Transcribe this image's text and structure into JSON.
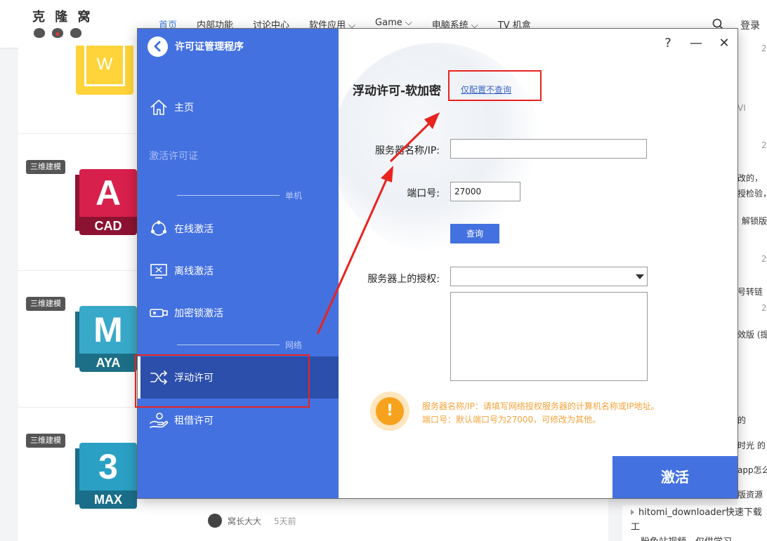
{
  "site": {
    "logo_text": "克 隆 窝",
    "nav": [
      "首页",
      "内部功能",
      "讨论中心",
      "软件应用 ⌵",
      "Game ⌵",
      "电脑系统 ⌵",
      "TV 机盒"
    ],
    "login": "登录",
    "tags": [
      "三维建模",
      "三维建模",
      "三维建模"
    ],
    "tiles": [
      {
        "letter": "A",
        "label": "CAD",
        "color": "#d8204c",
        "dark": "#8c1232"
      },
      {
        "letter": "M",
        "label": "AYA",
        "color": "#39a9c9",
        "dark": "#1c6f87"
      },
      {
        "letter": "3",
        "label": "MAX",
        "color": "#2aa0c4",
        "dark": "#1a6e89"
      }
    ],
    "word_letter": "W",
    "author": "窝长大大",
    "author_time": "5天前",
    "right_fragments": [
      "2",
      "VI",
      "2",
      "改的，",
      "授检验，",
      "解锁版",
      "2",
      "号转链",
      "2",
      "效版 (提",
      "的",
      "时光 的",
      "app怎么",
      "版资源",
      "2"
    ],
    "right_list": [
      "hitomi_downloader快速下载工",
      "粉色站视频，仅供学习"
    ]
  },
  "dialog": {
    "title": "许可证管理程序",
    "window_buttons": {
      "help": "?",
      "minimize": "—",
      "close": "✕"
    },
    "sidebar": {
      "home": "主页",
      "activate_license": "激活许可证",
      "section_standalone": "单机",
      "online": "在线激活",
      "offline": "离线激活",
      "dongle": "加密锁激活",
      "section_network": "网络",
      "floating": "浮动许可",
      "borrow": "租借许可"
    },
    "main": {
      "title": "浮动许可-软加密",
      "config_link": "仅配置不查询",
      "server_label": "服务器名称/IP:",
      "server_value": "",
      "port_label": "端口号:",
      "port_value": "27000",
      "query_button": "查询",
      "auth_label": "服务器上的授权:",
      "auth_value": "",
      "hint_line1": "服务器名称/IP：请填写网络授权服务器的计算机名称或IP地址。",
      "hint_line2": "端口号：默认端口号为27000，可修改为其他。",
      "activate_button": "激活"
    }
  },
  "colors": {
    "sidebar_bg": "#4471e0",
    "sidebar_active": "#2c4fab",
    "accent": "#4471e0",
    "warning": "#f7a21d",
    "annotation_red": "#e8231f"
  }
}
